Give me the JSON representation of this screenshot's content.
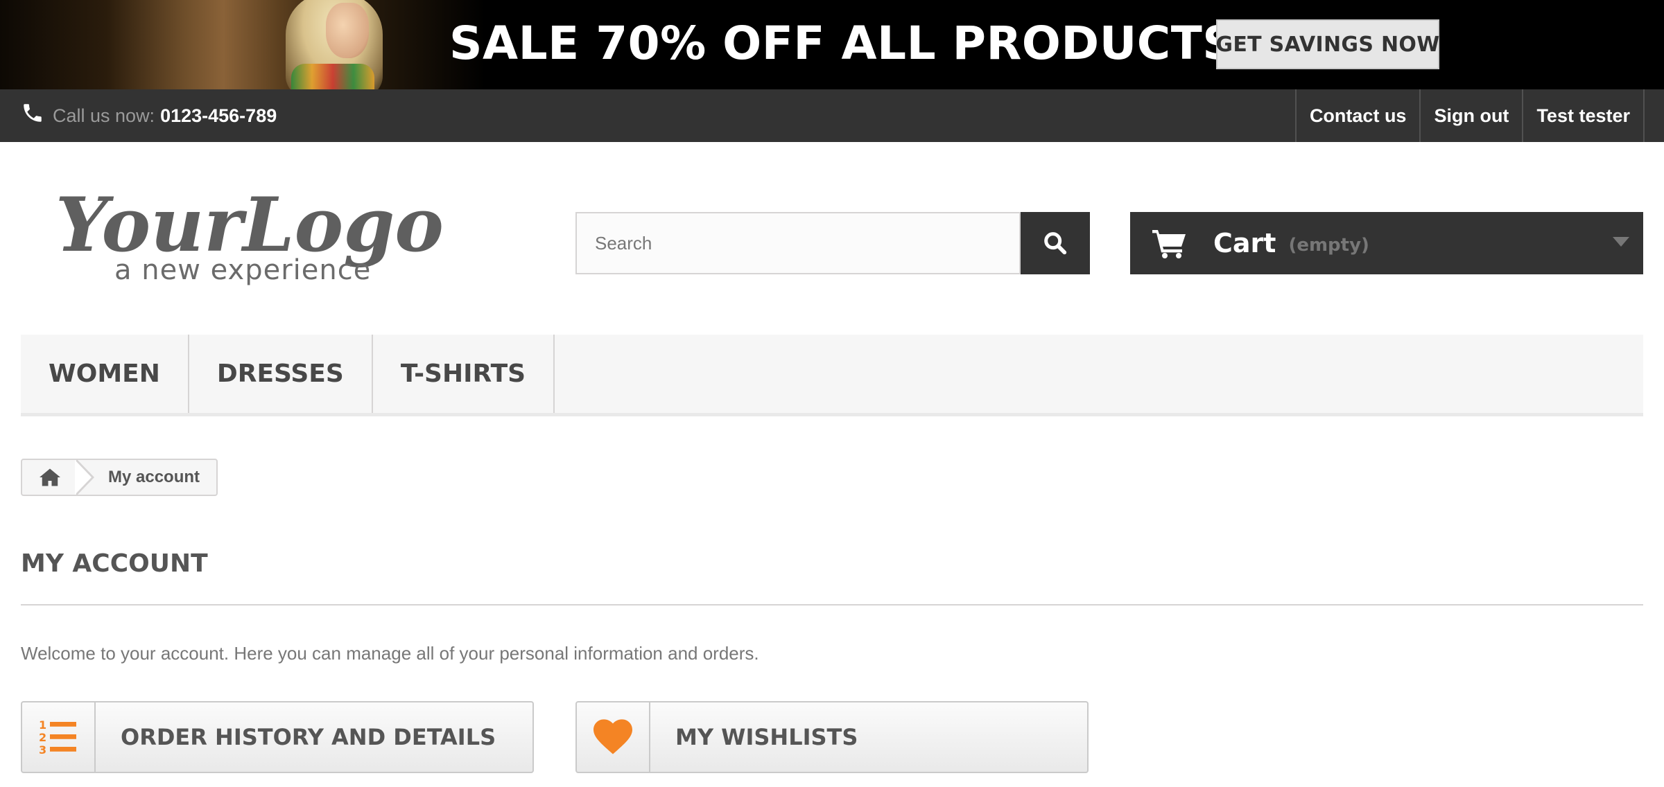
{
  "banner": {
    "headline": "SALE 70% OFF ALL PRODUCTS",
    "cta_label": "GET SAVINGS NOW"
  },
  "topnav": {
    "phone_icon": "phone-icon",
    "call_label": "Call us now:",
    "phone_number": "0123-456-789",
    "links": [
      "Contact us",
      "Sign out",
      "Test tester"
    ]
  },
  "header": {
    "logo_text": "YourLogo",
    "logo_tagline": "a new experience",
    "search": {
      "placeholder": "Search",
      "icon": "search-icon"
    },
    "cart": {
      "label": "Cart",
      "status": "(empty)",
      "icon": "cart-icon"
    }
  },
  "menu": {
    "items": [
      "WOMEN",
      "DRESSES",
      "T-SHIRTS"
    ]
  },
  "breadcrumb": {
    "home_icon": "home-icon",
    "current": "My account"
  },
  "page": {
    "title": "MY ACCOUNT",
    "welcome": "Welcome to your account. Here you can manage all of your personal information and orders.",
    "actions": [
      {
        "label": "ORDER HISTORY AND DETAILS",
        "icon": "numbered-list-icon"
      },
      {
        "label": "MY WISHLISTS",
        "icon": "heart-icon"
      }
    ]
  },
  "colors": {
    "dark": "#333333",
    "accent_orange": "#f48424",
    "menu_bg": "#f6f6f6",
    "border": "#d6d4d4"
  }
}
